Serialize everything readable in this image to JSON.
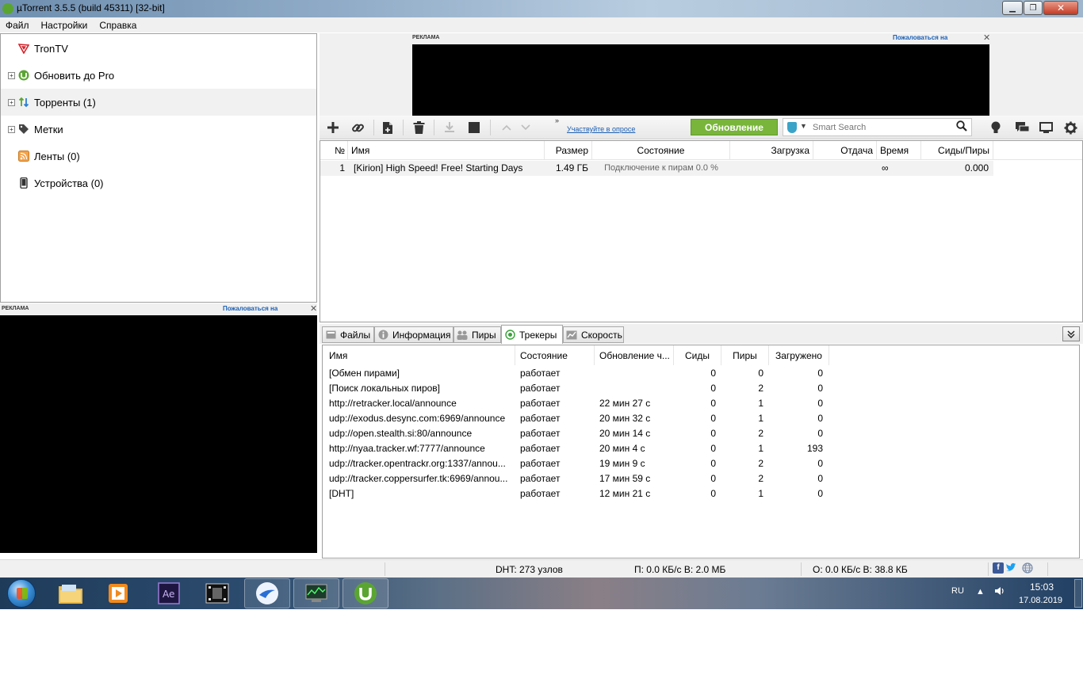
{
  "window": {
    "title": "µTorrent 3.5.5  (build 45311) [32-bit]"
  },
  "menu": [
    "Файл",
    "Настройки",
    "Справка"
  ],
  "sidebar": {
    "items": [
      {
        "label": "TronTV",
        "icon": "trontv-icon"
      },
      {
        "label": "Обновить до Pro",
        "icon": "utorrent-pro-icon"
      },
      {
        "label": "Торренты (1)",
        "icon": "torrents-icon"
      },
      {
        "label": "Метки",
        "icon": "label-icon"
      },
      {
        "label": "Ленты (0)",
        "icon": "rss-feed-icon"
      },
      {
        "label": "Устройства (0)",
        "icon": "device-icon"
      }
    ]
  },
  "ads": {
    "label": "РЕКЛАМА",
    "report": "Пожаловаться на",
    "close": "✕"
  },
  "toolbar": {
    "survey_link": "Участвуйте в опросе",
    "survey_chevron": "»",
    "update_button": "Обновление",
    "search_placeholder": "Smart Search"
  },
  "torrents": {
    "columns": [
      "№",
      "Имя",
      "Размер",
      "Состояние",
      "Загрузка",
      "Отдача",
      "Время",
      "Сиды/Пиры"
    ],
    "rows": [
      {
        "num": "1",
        "name": "[Kirion] High Speed! Free! Starting Days",
        "size": "1.49 ГБ",
        "status": "Подключение к пирам 0.0 %",
        "download": "",
        "upload": "",
        "time": "∞",
        "ratio": "0.000"
      }
    ]
  },
  "tabs": [
    "Файлы",
    "Информация",
    "Пиры",
    "Трекеры",
    "Скорость"
  ],
  "active_tab": "Трекеры",
  "trackers": {
    "columns": [
      "Имя",
      "Состояние",
      "Обновление ч...",
      "Сиды",
      "Пиры",
      "Загружено"
    ],
    "rows": [
      {
        "name": "[Обмен пирами]",
        "status": "работает",
        "update": "",
        "seeds": "0",
        "peers": "0",
        "downloaded": "0"
      },
      {
        "name": "[Поиск локальных пиров]",
        "status": "работает",
        "update": "",
        "seeds": "0",
        "peers": "2",
        "downloaded": "0"
      },
      {
        "name": "http://retracker.local/announce",
        "status": "работает",
        "update": "22 мин 27 с",
        "seeds": "0",
        "peers": "1",
        "downloaded": "0"
      },
      {
        "name": "udp://exodus.desync.com:6969/announce",
        "status": "работает",
        "update": "20 мин 32 с",
        "seeds": "0",
        "peers": "1",
        "downloaded": "0"
      },
      {
        "name": "udp://open.stealth.si:80/announce",
        "status": "работает",
        "update": "20 мин 14 с",
        "seeds": "0",
        "peers": "2",
        "downloaded": "0"
      },
      {
        "name": "http://nyaa.tracker.wf:7777/announce",
        "status": "работает",
        "update": "20 мин 4 с",
        "seeds": "0",
        "peers": "1",
        "downloaded": "193"
      },
      {
        "name": "udp://tracker.opentrackr.org:1337/annou...",
        "status": "работает",
        "update": "19 мин 9 с",
        "seeds": "0",
        "peers": "2",
        "downloaded": "0"
      },
      {
        "name": "udp://tracker.coppersurfer.tk:6969/annou...",
        "status": "работает",
        "update": "17 мин 59 с",
        "seeds": "0",
        "peers": "2",
        "downloaded": "0"
      },
      {
        "name": "[DHT]",
        "status": "работает",
        "update": "12 мин 21 с",
        "seeds": "0",
        "peers": "1",
        "downloaded": "0"
      }
    ]
  },
  "statusbar": {
    "dht": "DHT: 273 узлов",
    "download": "П: 0.0 КБ/с В: 2.0 МБ",
    "upload": "О: 0.0 КБ/с В: 38.8 КБ"
  },
  "taskbar": {
    "language": "RU",
    "time": "15:03",
    "date": "17.08.2019",
    "apps": [
      "file-explorer",
      "media-player",
      "after-effects",
      "video-editor",
      "browser",
      "task-manager",
      "utorrent"
    ]
  },
  "colors": {
    "update_green": "#78b53a",
    "link_blue": "#1a5fb4",
    "utorrent_green": "#5aa532"
  }
}
